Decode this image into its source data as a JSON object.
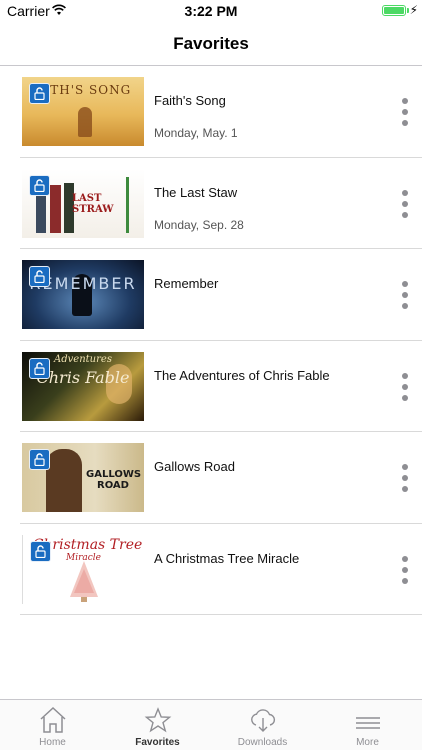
{
  "status_bar": {
    "carrier": "Carrier",
    "time": "3:22 PM",
    "battery_level": 1.0,
    "battery_color": "#4cd964"
  },
  "nav": {
    "title": "Favorites"
  },
  "favorites": [
    {
      "title": "Faith's Song",
      "date": "Monday, May. 1",
      "poster_text": "AITH'S SONG",
      "icon": "lock-icon"
    },
    {
      "title": "The Last Staw",
      "date": "Monday, Sep. 28",
      "poster_text": "LAST STRAW",
      "icon": "lock-icon"
    },
    {
      "title": "Remember",
      "date": "",
      "poster_text": "REMEMBER",
      "icon": "lock-icon"
    },
    {
      "title": "The Adventures of Chris Fable",
      "date": "",
      "poster_text": "Chris Fable",
      "poster_text_small": "Adventures",
      "icon": "lock-icon"
    },
    {
      "title": "Gallows Road",
      "date": "",
      "poster_text": "GALLOWS ROAD",
      "icon": "lock-icon"
    },
    {
      "title": "A Christmas Tree Miracle",
      "date": "",
      "poster_text": "Christmas Tree",
      "poster_text_small": "Miracle",
      "icon": "lock-icon"
    }
  ],
  "tabs": [
    {
      "label": "Home",
      "icon": "home-icon",
      "active": false
    },
    {
      "label": "Favorites",
      "icon": "star-icon",
      "active": true
    },
    {
      "label": "Downloads",
      "icon": "cloud-download-icon",
      "active": false
    },
    {
      "label": "More",
      "icon": "menu-icon",
      "active": false
    }
  ],
  "colors": {
    "lock_badge": "#1a6cc1",
    "separator": "#d9d9d9",
    "tab_inactive": "#8e8e93"
  }
}
